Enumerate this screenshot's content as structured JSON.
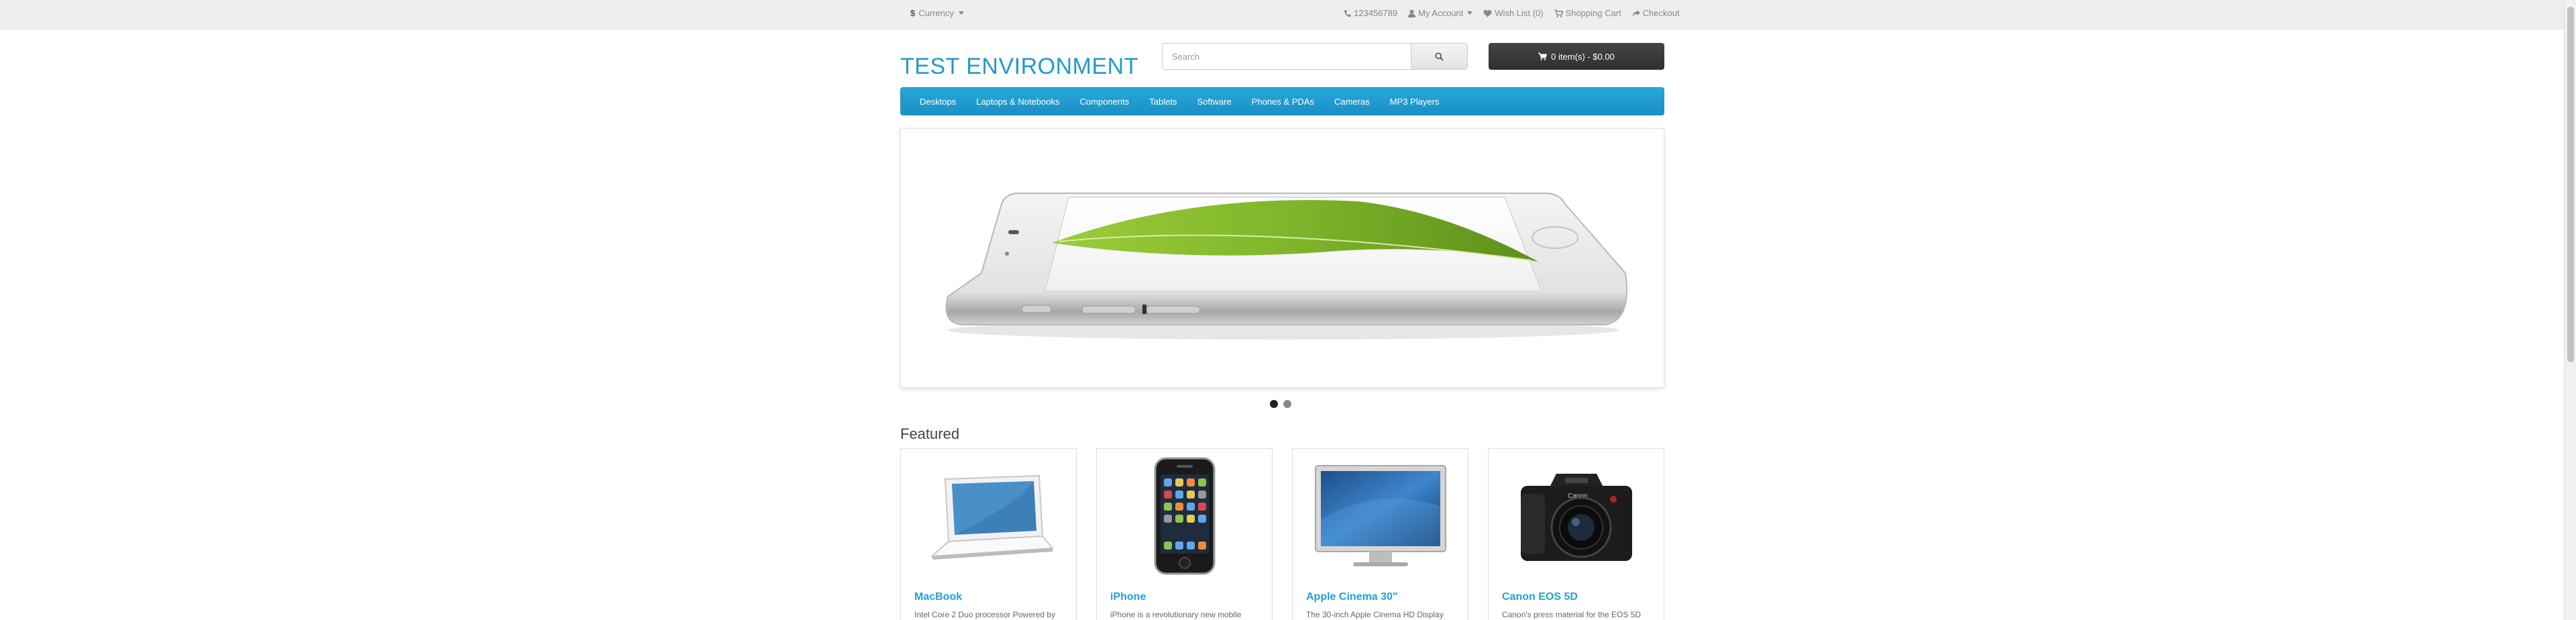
{
  "topbar": {
    "currency_symbol": "$",
    "currency_label": "Currency",
    "phone": "123456789",
    "my_account": "My Account",
    "wishlist": "Wish List (0)",
    "shopping_cart": "Shopping Cart",
    "checkout": "Checkout"
  },
  "header": {
    "logo": "TEST ENVIRONMENT",
    "search_placeholder": "Search",
    "cart_label": "0 item(s) - $0.00"
  },
  "menu": {
    "items": [
      "Desktops",
      "Laptops & Notebooks",
      "Components",
      "Tablets",
      "Software",
      "Phones & PDAs",
      "Cameras",
      "MP3 Players"
    ]
  },
  "slideshow": {
    "active_dot": 1,
    "dot_count": 2
  },
  "featured": {
    "title": "Featured",
    "products": [
      {
        "name": "MacBook",
        "desc": "Intel Core 2 Duo processor Powered by",
        "icon": "macbook-image"
      },
      {
        "name": "iPhone",
        "desc": "iPhone is a revolutionary new mobile",
        "icon": "iphone-image"
      },
      {
        "name": "Apple Cinema 30\"",
        "desc": "The 30-inch Apple Cinema HD Display",
        "icon": "cinema-display-image"
      },
      {
        "name": "Canon EOS 5D",
        "desc": "Canon's press material for the EOS 5D",
        "icon": "camera-image"
      }
    ]
  },
  "colors": {
    "accent": "#229ac8",
    "menu": "#229ac8",
    "cart_bg": "#363636"
  }
}
